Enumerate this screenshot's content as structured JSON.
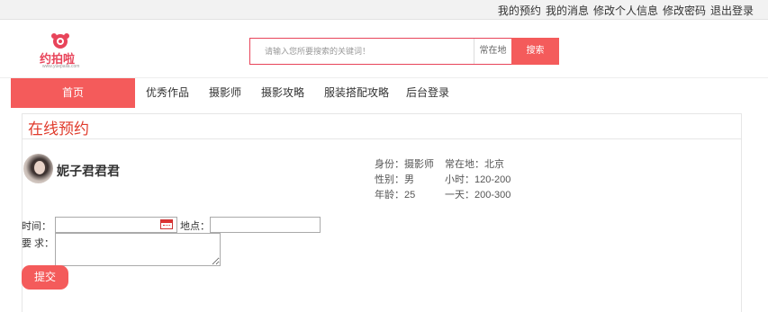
{
  "toplinks": [
    "我的预约",
    "我的消息",
    "修改个人信息",
    "修改密码",
    "退出登录"
  ],
  "logo": {
    "text": "约拍啦",
    "sub": "www.yuepaila.com"
  },
  "search": {
    "placeholder": "请输入您所要搜索的关键词！",
    "scope": "常在地",
    "button": "搜索"
  },
  "nav": [
    "首页",
    "优秀作品",
    "摄影师",
    "摄影攻略",
    "服装搭配攻略",
    "后台登录"
  ],
  "panel": {
    "title": "在线预约"
  },
  "photographer": {
    "name": "妮子君君君",
    "identity": "身份：摄影师",
    "gender": "性别：男",
    "age": "年龄：25",
    "location": "常在地：北京",
    "hourly": "小时：120-200",
    "daily": "一天：200-300"
  },
  "form": {
    "time_label": "时间：",
    "place_label": "地点：",
    "req_label": "要 求：",
    "submit": "提交"
  },
  "colors": {
    "accent": "#f45b5b",
    "title": "#e03b2c"
  }
}
